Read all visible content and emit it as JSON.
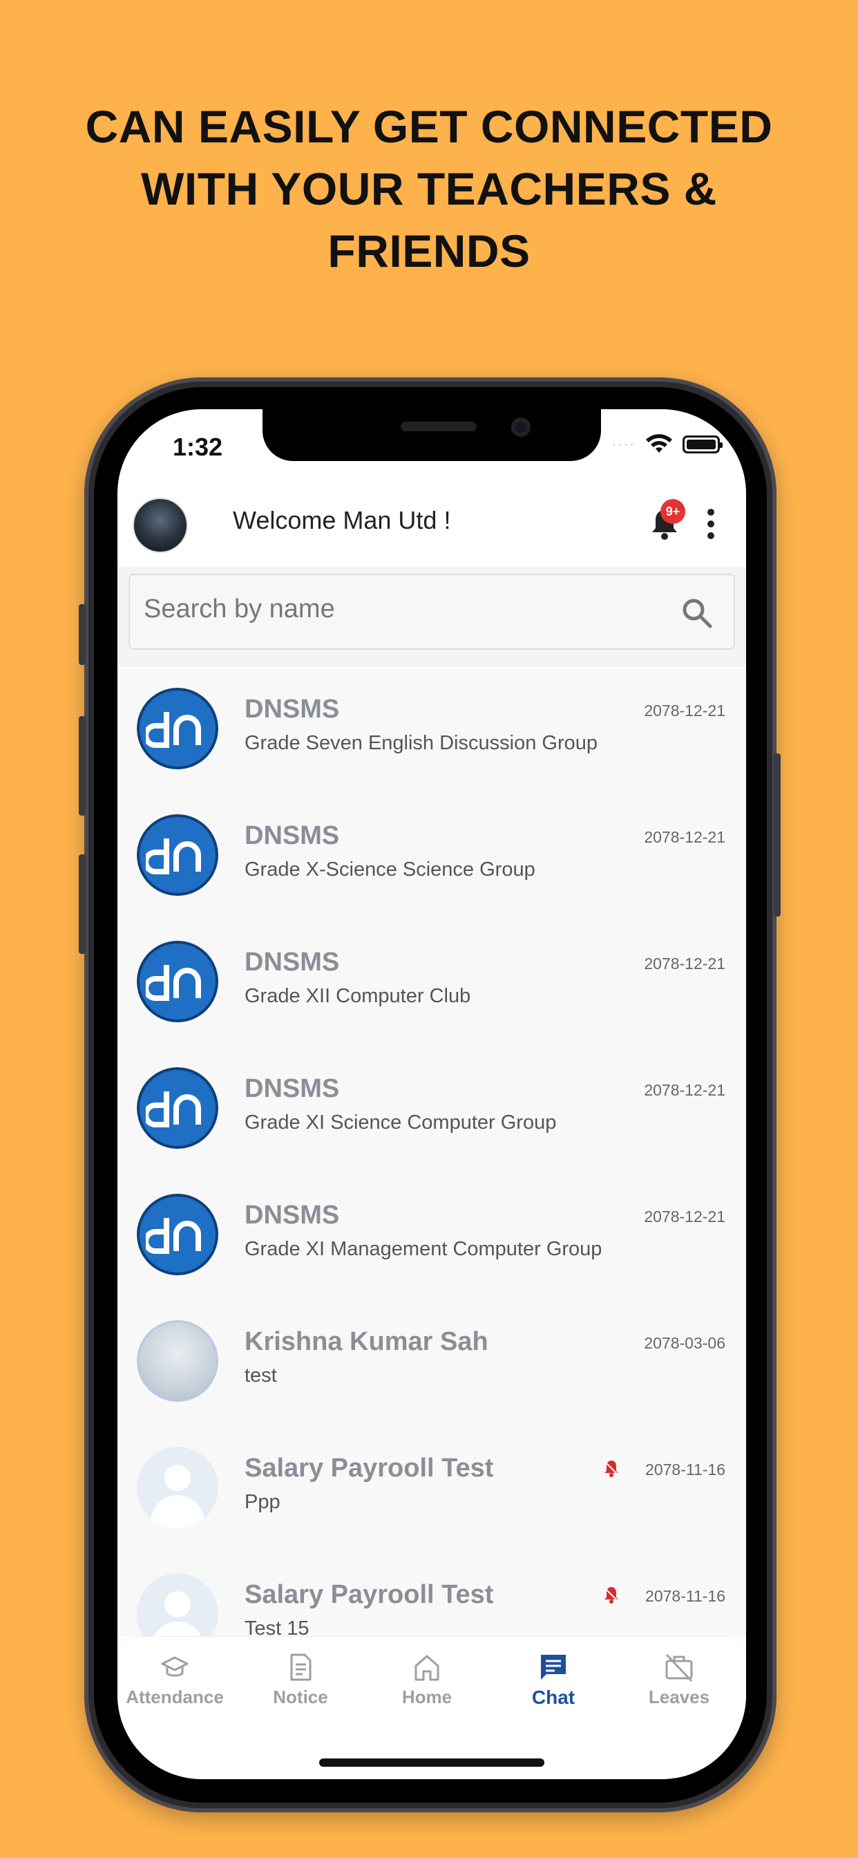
{
  "headline": [
    "CAN EASILY GET CONNECTED",
    "WITH YOUR TEACHERS &",
    "FRIENDS"
  ],
  "status_bar": {
    "time": "1:32"
  },
  "header": {
    "welcome_text": "Welcome Man Utd !",
    "notification_badge": "9+"
  },
  "search": {
    "placeholder": "Search by name",
    "value": ""
  },
  "chats": [
    {
      "name": "DNSMS",
      "subtitle": "Grade Seven English Discussion Group",
      "date": "2078-12-21",
      "avatar": "dn-logo",
      "muted": false
    },
    {
      "name": "DNSMS",
      "subtitle": "Grade X-Science Science Group",
      "date": "2078-12-21",
      "avatar": "dn-logo",
      "muted": false
    },
    {
      "name": "DNSMS",
      "subtitle": "Grade XII Computer Club",
      "date": "2078-12-21",
      "avatar": "dn-logo",
      "muted": false
    },
    {
      "name": "DNSMS",
      "subtitle": "Grade XI Science Computer Group",
      "date": "2078-12-21",
      "avatar": "dn-logo",
      "muted": false
    },
    {
      "name": "DNSMS",
      "subtitle": "Grade XI Management Computer Group",
      "date": "2078-12-21",
      "avatar": "dn-logo",
      "muted": false
    },
    {
      "name": "Krishna Kumar Sah",
      "subtitle": "test",
      "date": "2078-03-06",
      "avatar": "photo",
      "muted": false
    },
    {
      "name": "Salary Payrooll Test",
      "subtitle": "Ppp",
      "date": "2078-11-16",
      "avatar": "default-user",
      "muted": true
    },
    {
      "name": "Salary Payrooll Test",
      "subtitle": "Test 15",
      "date": "2078-11-16",
      "avatar": "default-user",
      "muted": true
    }
  ],
  "tabs": [
    {
      "label": "Attendance",
      "icon": "graduation-cap-icon",
      "active": false
    },
    {
      "label": "Notice",
      "icon": "document-icon",
      "active": false
    },
    {
      "label": "Home",
      "icon": "home-icon",
      "active": false
    },
    {
      "label": "Chat",
      "icon": "chat-icon",
      "active": true
    },
    {
      "label": "Leaves",
      "icon": "briefcase-off-icon",
      "active": false
    }
  ],
  "colors": {
    "background": "#FDB24C",
    "accent": "#1f4e9c",
    "badge": "#E63232",
    "dn_logo": "#1F6FC4"
  }
}
